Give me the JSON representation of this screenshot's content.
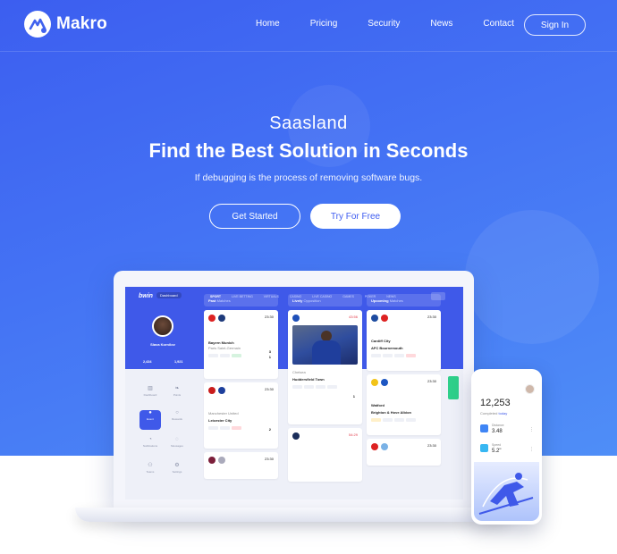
{
  "brand": {
    "name": "Makro"
  },
  "nav": {
    "items": [
      "Home",
      "Pricing",
      "Security",
      "News",
      "Contact"
    ],
    "signin": "Sign In"
  },
  "hero": {
    "kicker": "Saasland",
    "title": "Find the Best Solution in Seconds",
    "subtitle": "If debugging is the process of removing software bugs.",
    "cta_primary": "Get Started",
    "cta_secondary": "Try For Free"
  },
  "colors": {
    "accent": "#3f59e9",
    "hero_from": "#3c5ef0",
    "hero_to": "#4f8ef7",
    "green": "#2ecf8a"
  },
  "dashboard": {
    "brand": "bwin",
    "dashboard_label": "Dashboard",
    "topnav": [
      "SPORT",
      "LIVE BETTING",
      "VIRTUALS",
      "CASINO",
      "LIVE CASINO",
      "GAMES",
      "POKER",
      "NEWS"
    ],
    "user": {
      "name": "Slava Kornilov",
      "stat1": "2,434",
      "stat2": "1,921"
    },
    "menu": [
      "Dashboard",
      "Points",
      "Event",
      "Rewards",
      "Notifications",
      "Messages",
      "Teams",
      "Settings"
    ],
    "columns": [
      {
        "title": "Past",
        "subtitle": "Matches"
      },
      {
        "title": "Lively",
        "subtitle": "Opposition"
      },
      {
        "title": "Upcoming",
        "subtitle": "Matches"
      }
    ],
    "matches": {
      "past1": {
        "time": "23:30",
        "home": "Bayern Munich",
        "away": "Paris Saint-Germain",
        "score_home": "3",
        "score_away": "1"
      },
      "past2": {
        "time": "23:30",
        "home": "Manchester United",
        "away": "Leicester City",
        "score_home": "2",
        "score_away": ""
      },
      "past3": {
        "time": "23:30"
      },
      "live1": {
        "time": "43:56",
        "home": "Chelsea",
        "away": "Huddersfield Town",
        "score_home": "",
        "score_away": "1"
      },
      "live2": {
        "time": "54:29"
      },
      "up1": {
        "time": "23:30",
        "home": "Cardiff City",
        "away": "AFC Bournemouth"
      },
      "up2": {
        "time": "23:30",
        "home": "Watford",
        "away": "Brighton & Hove Albion"
      },
      "up3": {
        "time": "23:30"
      }
    }
  },
  "phone": {
    "steps": "12,253",
    "completed_label": "Completed",
    "completed_when": "today",
    "rows": [
      {
        "label": "Distance",
        "value": "3.48"
      },
      {
        "label": "Speed",
        "value": "5.2\""
      }
    ]
  }
}
